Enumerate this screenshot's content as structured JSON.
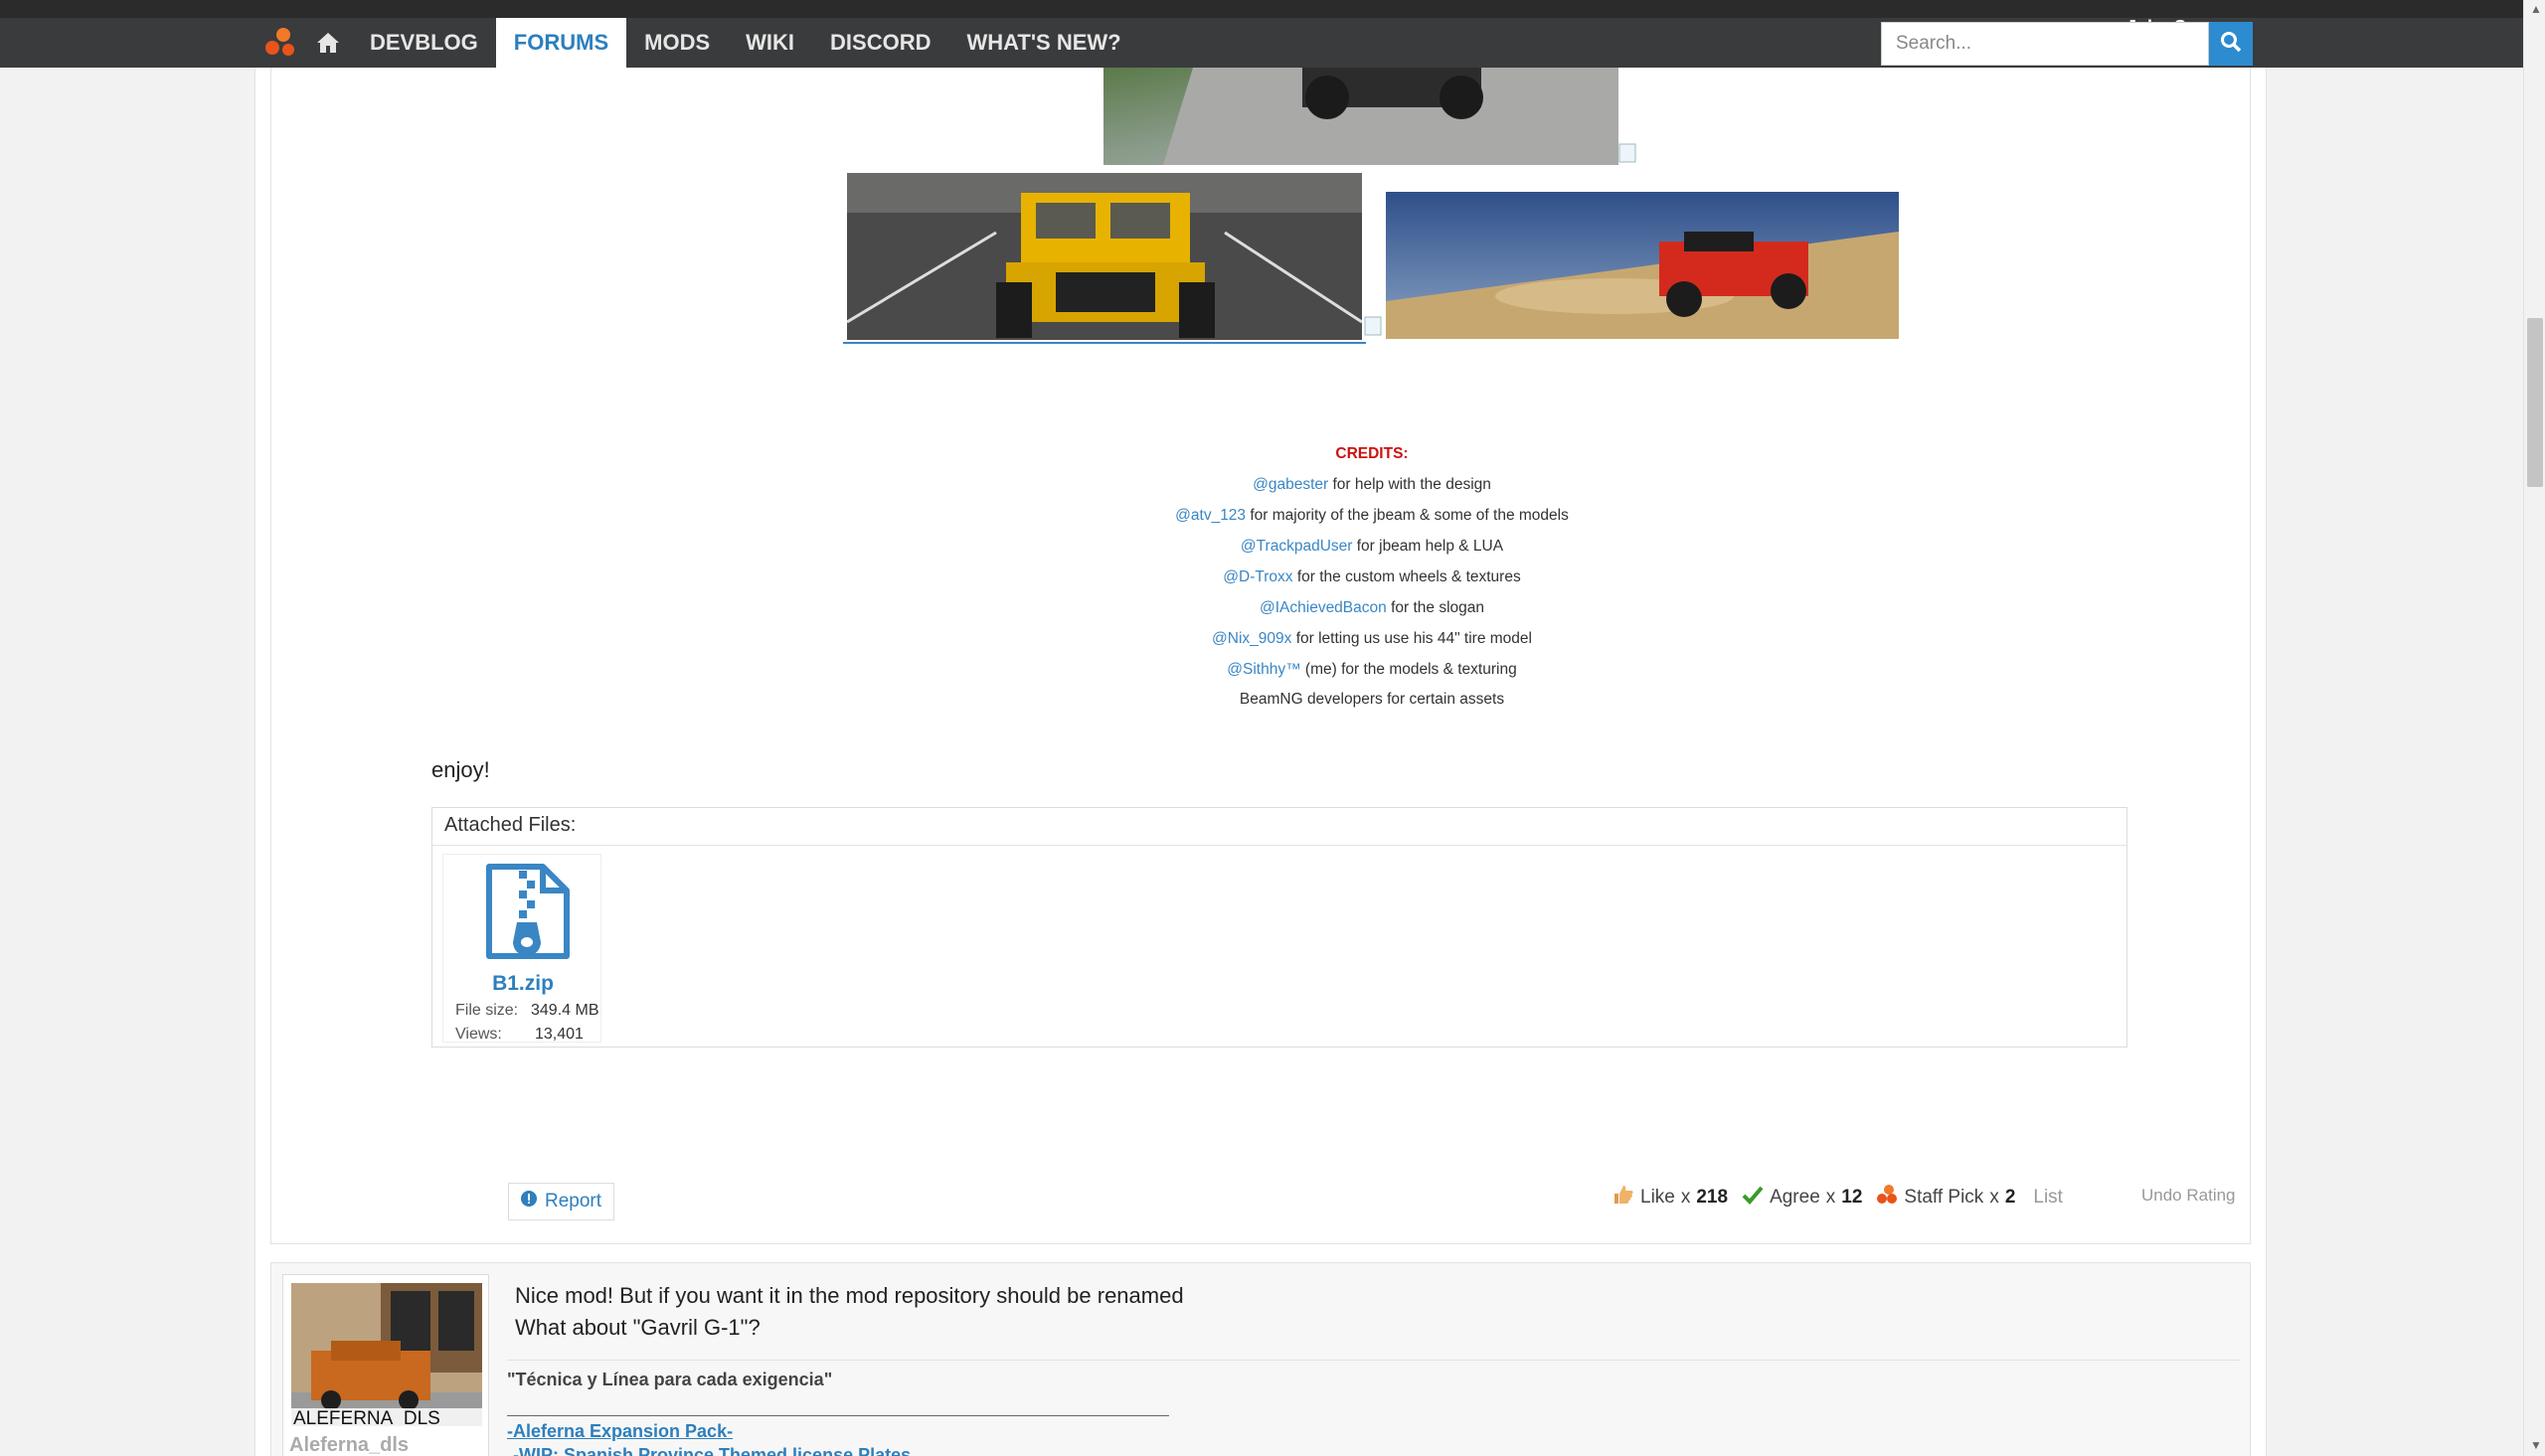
{
  "nav": {
    "items": [
      "DEVBLOG",
      "FORUMS",
      "MODS",
      "WIKI",
      "DISCORD",
      "WHAT'S NEW?"
    ],
    "active": "FORUMS",
    "user": "John Sanaro",
    "search_placeholder": "Search..."
  },
  "credits": {
    "title": "CREDITS:",
    "lines": [
      {
        "user": "@gabester",
        "text": " for help with the design"
      },
      {
        "user": "@atv_123",
        "text": " for majority of the jbeam & some of the models"
      },
      {
        "user": "@TrackpadUser",
        "text": " for jbeam help & LUA"
      },
      {
        "user": "@D-Troxx",
        "text": " for the custom wheels & textures"
      },
      {
        "user": "@IAchievedBacon",
        "text": " for the slogan"
      },
      {
        "user": "@Nix_909x",
        "text": " for letting us use his 44\" tire model"
      },
      {
        "user": "@Sithhy™",
        "text": " (me) for the models & texturing"
      },
      {
        "user": "",
        "text": "BeamNG developers for certain assets"
      }
    ]
  },
  "post": {
    "enjoy": "enjoy!",
    "attached_label": "Attached Files:",
    "file": {
      "name": "B1.zip",
      "size_label": "File size:",
      "size": "349.4 MB",
      "views_label": "Views:",
      "views": "13,401"
    },
    "report": "Report",
    "ratings": [
      {
        "label": "Like",
        "count": "218",
        "icon": "thumbs-up-icon"
      },
      {
        "label": "Agree",
        "count": "12",
        "icon": "check-icon"
      },
      {
        "label": "Staff Pick",
        "count": "2",
        "icon": "beamng-logo-icon"
      }
    ],
    "list": "List",
    "undo": "Undo Rating"
  },
  "reply": {
    "author": "Aleferna_dls",
    "avatar_text": "ALEFERNA_DLS",
    "message_line1": "Nice mod! But if you want it in the mod repository should be renamed",
    "message_line2": "What about \"Gavril G-1\"?",
    "signature_quote": "\"Técnica y Línea para cada exigencia\"",
    "signature_link1": "-Aleferna Expansion Pack-",
    "signature_link2": "-WIP: Spanish Province Themed license Plates"
  },
  "colors": {
    "accent": "#2d7fbd",
    "credits_title": "#cc1111",
    "navbar": "#3a3b3d"
  }
}
